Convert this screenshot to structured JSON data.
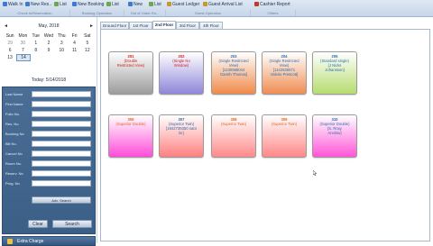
{
  "ribbon": {
    "buttons": [
      {
        "label": "Walk In",
        "color": "#3b7bd1"
      },
      {
        "label": "New Res..",
        "color": "#3b7bd1"
      },
      {
        "label": "List",
        "color": "#6aa84f"
      },
      {
        "label": "New Booking",
        "color": "#3b7bd1"
      },
      {
        "label": "List",
        "color": "#6aa84f"
      },
      {
        "label": "New",
        "color": "#3b7bd1"
      },
      {
        "label": "List",
        "color": "#6aa84f"
      },
      {
        "label": "Guest Ledger",
        "color": "#c49a2c"
      },
      {
        "label": "Guest Arrival List",
        "color": "#c49a2c"
      },
      {
        "label": "Cashier Report",
        "color": "#c0392b"
      }
    ],
    "groups": [
      "Check In/Reservation",
      "Booking Operation",
      "Out of Order Ro...",
      "Guest Operation",
      "Others"
    ]
  },
  "calendar": {
    "month_label": "May, 2018",
    "prev_arrow": "◄",
    "next_arrow": "►",
    "weekdays": [
      "Sun",
      "Mon",
      "Tue",
      "Wed",
      "Thu",
      "Fri",
      "Sat"
    ],
    "week1": [
      "29",
      "30",
      "1",
      "2",
      "3",
      "4",
      "5"
    ],
    "week2": [
      "6",
      "7",
      "8",
      "9",
      "10",
      "11",
      "12"
    ],
    "week3": [
      "13",
      "14",
      "",
      "",
      "",
      "",
      ""
    ],
    "selected_day": "14"
  },
  "today_label": "Today: 5/14/2018",
  "search_fields": [
    "Last Name",
    "First Name",
    "Folio No.",
    "Res. No.",
    "Booking No",
    "Bill No.",
    "Cancel No",
    "Room No.",
    "Reserv. No",
    "Prog.  No"
  ],
  "buttons": {
    "advance_search": "Adv.  Search",
    "clear": "Clear",
    "search": "Search",
    "extra_charge": "Extra Charge"
  },
  "floor_tabs": [
    "Ground Floor",
    "1st Floor",
    "2nd Floor",
    "3rd Floor",
    "4th Floor"
  ],
  "active_tab": "2nd Floor",
  "rooms_row1": [
    {
      "num": "201",
      "text": "(Double\nRestricted View)",
      "num_color": "#d42020",
      "bg": "linear-gradient(#ffffff, #9c9c9c)"
    },
    {
      "num": "202",
      "text": "(Single No\nWindow)",
      "num_color": "#d42020",
      "bg": "linear-gradient(#ffffff, #8f86d9)"
    },
    {
      "num": "203",
      "text": "(Single Restricted\nView)\n[1230985044\nGareth Thomas]",
      "num_color": "#2a6fb0",
      "bg": "linear-gradient(#ffffff, #f08a4a)"
    },
    {
      "num": "204",
      "text": "(Single Restricted\nView)\n[1142535571\nValerie Prescott]",
      "num_color": "#2a6fb0",
      "bg": "linear-gradient(#ffffff, #ef8d52)"
    },
    {
      "num": "205",
      "text": "(Standard single)\n[J Nicks\nJohansson]",
      "num_color": "#2a6fb0",
      "bg": "linear-gradient(#ffffff, #b6dc6e)"
    }
  ],
  "rooms_row2": [
    {
      "num": "306",
      "text": "(Superior Double)",
      "num_color": "#e06a20",
      "bg": "linear-gradient(#ffffff, #ff4cd9)"
    },
    {
      "num": "307",
      "text": "(Superior Twin)\n[1842739350 sara\nlie]",
      "num_color": "#2a6fb0",
      "bg": "linear-gradient(#ffffff, #ff7f7f)"
    },
    {
      "num": "308",
      "text": "(Superior Twin)",
      "num_color": "#e06a20",
      "bg": "linear-gradient(#ffffff, #ff8a8a)"
    },
    {
      "num": "309",
      "text": "(Superior Twin)",
      "num_color": "#e06a20",
      "bg": "linear-gradient(#ffffff, #ff8787)"
    },
    {
      "num": "310",
      "text": "(Superior Double)\n[S. Roxy\nAnoloiu]",
      "num_color": "#2a6fb0",
      "bg": "linear-gradient(#ffffff, #ff55d8)"
    }
  ]
}
